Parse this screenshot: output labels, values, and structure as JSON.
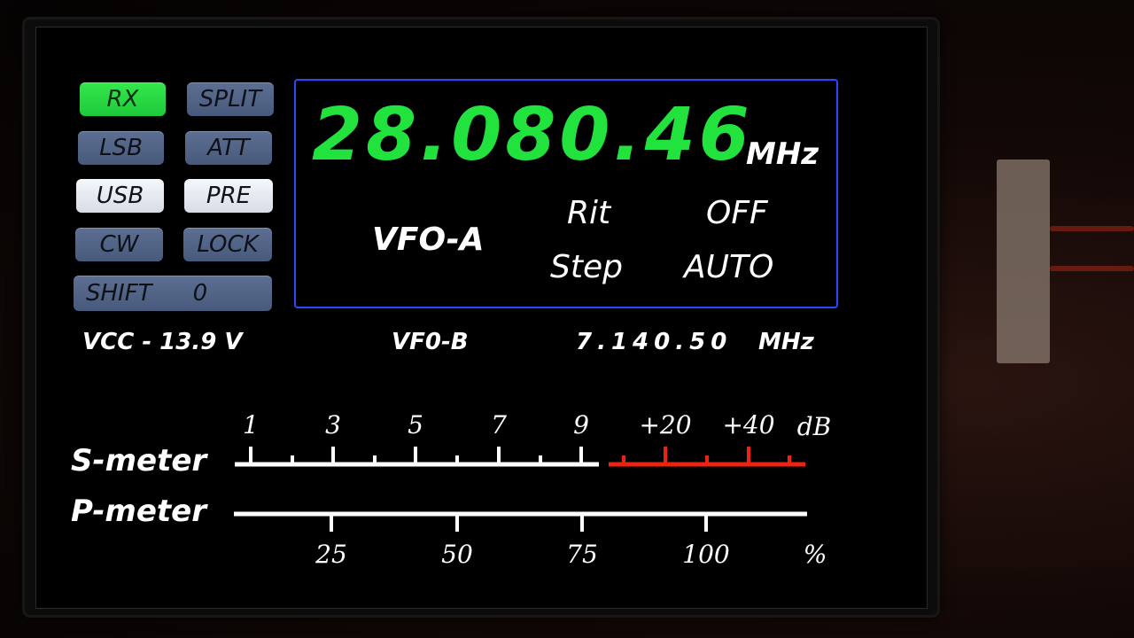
{
  "buttons": {
    "rx": {
      "label": "RX",
      "state": "active"
    },
    "split": {
      "label": "SPLIT",
      "state": "inactive"
    },
    "lsb": {
      "label": "LSB",
      "state": "inactive"
    },
    "att": {
      "label": "ATT",
      "state": "inactive"
    },
    "usb": {
      "label": "USB",
      "state": "selected"
    },
    "pre": {
      "label": "PRE",
      "state": "selected"
    },
    "cw": {
      "label": "CW",
      "state": "inactive"
    },
    "lock": {
      "label": "LOCK",
      "state": "inactive"
    },
    "shift": {
      "label": "SHIFT",
      "value": "0"
    }
  },
  "main": {
    "frequency": "28.080.46",
    "unit": "MHz",
    "vfo": "VFO-A",
    "rit_label": "Rit",
    "rit_value": "OFF",
    "step_label": "Step",
    "step_value": "AUTO"
  },
  "status": {
    "vcc": "VCC - 13.9 V",
    "vfo_b_label": "VF0-B",
    "vfo_b_frequency": "7.140.50",
    "vfo_b_unit": "MHz"
  },
  "smeter": {
    "label": "S-meter",
    "scale_labels": [
      "1",
      "3",
      "5",
      "7",
      "9",
      "+20",
      "+40"
    ],
    "unit": "dB",
    "level_fraction": 0
  },
  "pmeter": {
    "label": "P-meter",
    "scale_labels": [
      "25",
      "50",
      "75",
      "100"
    ],
    "unit": "%",
    "level_fraction": 0
  },
  "colors": {
    "frequency": "#22e33e",
    "rx_active": "#2fe048",
    "frame": "#2f46ff",
    "meter_over": "#ee2211",
    "meter_scale": "#ffffff"
  }
}
